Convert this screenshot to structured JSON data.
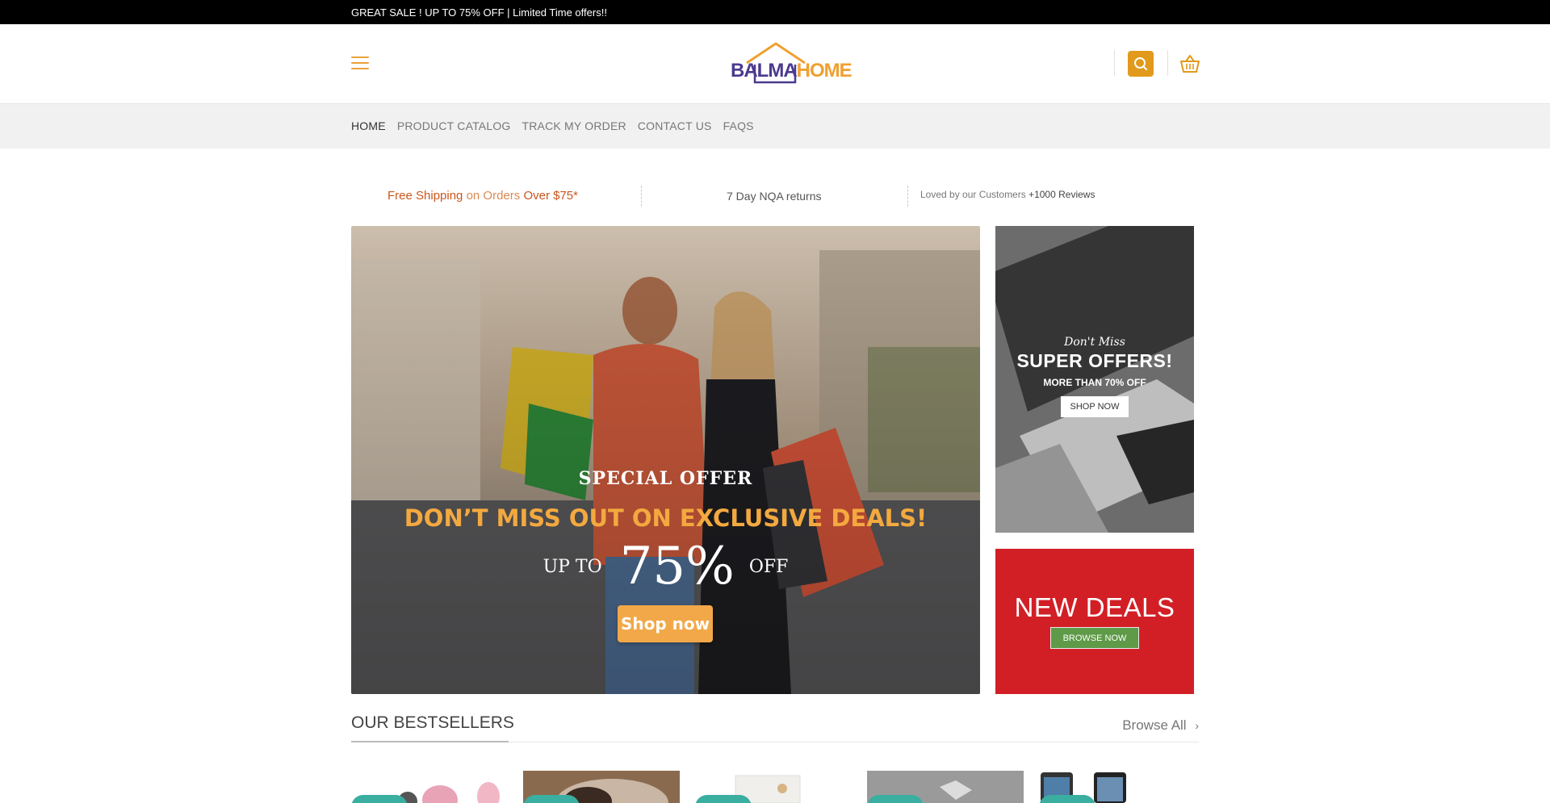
{
  "topbar": {
    "text": "GREAT SALE ! UP TO 75% OFF | Limited Time offers!!"
  },
  "header": {
    "logo": {
      "part1": "BALMA",
      "part2": "HOME"
    },
    "icons": [
      "menu-icon",
      "search-icon",
      "basket-icon"
    ]
  },
  "nav": {
    "items": [
      {
        "label": "HOME",
        "active": true
      },
      {
        "label": "PRODUCT CATALOG"
      },
      {
        "label": "TRACK MY ORDER"
      },
      {
        "label": "CONTACT US"
      },
      {
        "label": "FAQS"
      }
    ]
  },
  "features": {
    "shipping": {
      "a": "Free Shipping",
      "b": " on Orders ",
      "c": "Over $75*"
    },
    "returns": "7 Day NQA returns",
    "reviews": {
      "a": "Loved by our Customers ",
      "b": "+1000 Reviews"
    }
  },
  "hero": {
    "kicker": "SPECIAL OFFER",
    "headline": "DON’T MISS OUT ON EXCLUSIVE DEALS!",
    "up_to": "UP TO",
    "percent": "75%",
    "off": "OFF",
    "cta": "Shop now"
  },
  "promo1": {
    "script": "Don't Miss",
    "title": "SUPER OFFERS!",
    "subtitle": "MORE THAN 70% OFF",
    "cta": "SHOP NOW"
  },
  "promo2": {
    "title": "NEW DEALS",
    "cta": "BROWSE NOW"
  },
  "bestsellers": {
    "title": "OUR BESTSELLERS",
    "browse": "Browse All"
  },
  "colors": {
    "accent": "#e19a1b",
    "brand_purple": "#4b3a8f",
    "deals_red": "#d21f26",
    "browse_green": "#5e9a48",
    "badge_teal": "#3aaea0"
  }
}
